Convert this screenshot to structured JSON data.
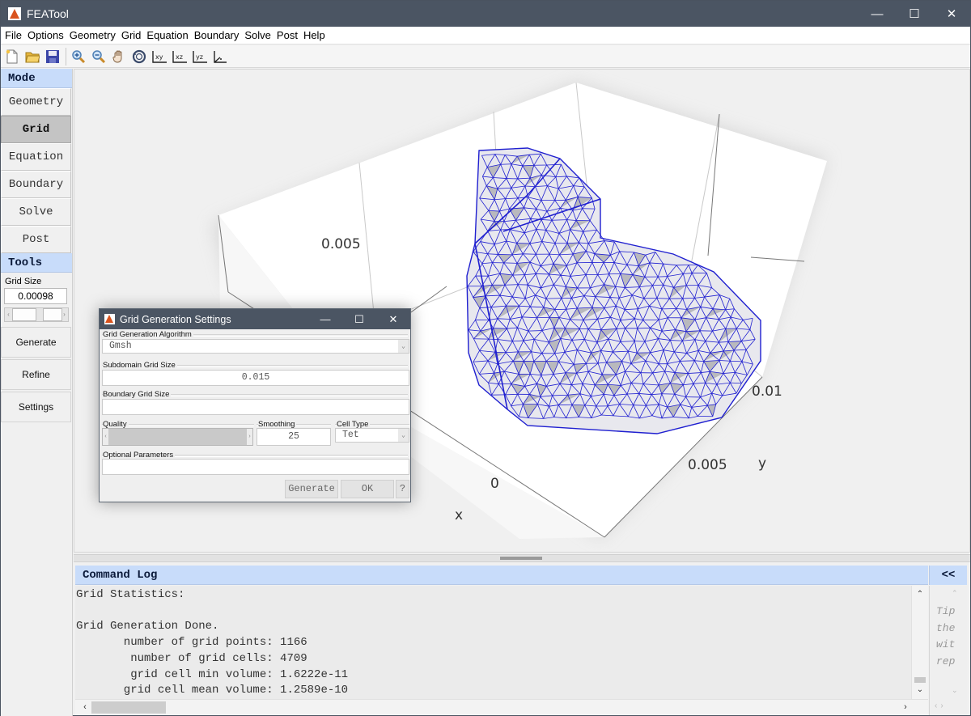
{
  "window": {
    "title": "FEATool",
    "controls": {
      "minimize": "—",
      "maximize": "☐",
      "close": "✕"
    }
  },
  "menubar": {
    "items": [
      "File",
      "Options",
      "Geometry",
      "Grid",
      "Equation",
      "Boundary",
      "Solve",
      "Post",
      "Help"
    ]
  },
  "toolbar": {
    "buttons": [
      {
        "icon": "new-file-icon"
      },
      {
        "icon": "open-folder-icon"
      },
      {
        "icon": "save-icon"
      },
      {
        "icon": "zoom-in-icon"
      },
      {
        "icon": "zoom-out-icon"
      },
      {
        "icon": "pan-hand-icon"
      },
      {
        "icon": "rotate-3d-icon"
      },
      {
        "icon": "view-xy-icon",
        "label": "xy"
      },
      {
        "icon": "view-xz-icon",
        "label": "xz"
      },
      {
        "icon": "view-yz-icon",
        "label": "yz"
      },
      {
        "icon": "view-3d-icon"
      }
    ]
  },
  "sidebar": {
    "mode_header": "Mode",
    "modes": [
      "Geometry",
      "Grid",
      "Equation",
      "Boundary",
      "Solve",
      "Post"
    ],
    "active_mode": "Grid",
    "tools_header": "Tools",
    "grid_size_label": "Grid Size",
    "grid_size_value": "0.00098",
    "tool_buttons": [
      "Generate",
      "Refine",
      "Settings"
    ]
  },
  "plot": {
    "axis_ticks": {
      "z_0_005": "0.005",
      "y_0_01": "0.01",
      "y_0_005": "0.005",
      "x_0": "0"
    },
    "axis_labels": {
      "x": "x",
      "y": "y"
    },
    "mesh_color": "#1f1fd0",
    "face_color": "#e8e8ee"
  },
  "dialog": {
    "title": "Grid Generation Settings",
    "algorithm_label": "Grid Generation Algorithm",
    "algorithm_value": "Gmsh",
    "subdomain_label": "Subdomain Grid Size",
    "subdomain_value": "0.015",
    "boundary_label": "Boundary Grid Size",
    "boundary_value": "",
    "quality_label": "Quality",
    "smoothing_label": "Smoothing",
    "smoothing_value": "25",
    "celltype_label": "Cell Type",
    "celltype_value": "Tet",
    "optional_label": "Optional Parameters",
    "optional_value": "",
    "buttons": {
      "generate": "Generate",
      "ok": "OK",
      "help": "?"
    }
  },
  "command_log": {
    "header": "Command Log",
    "toggle_label": "<<",
    "lines": [
      "Grid Statistics:",
      "",
      "Grid Generation Done.",
      "       number of grid points: 1166",
      "        number of grid cells: 4709",
      "        grid cell min volume: 1.6222e-11",
      "       grid cell mean volume: 1.2589e-10"
    ],
    "tips_lines": [
      "Tip",
      "the",
      "wit",
      "rep"
    ]
  }
}
